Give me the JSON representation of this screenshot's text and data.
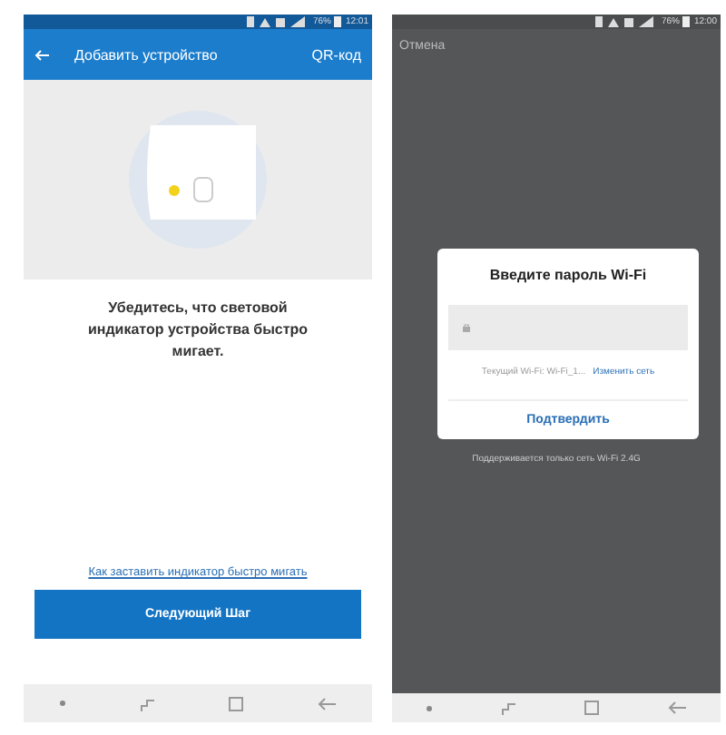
{
  "setup_screen": {
    "status_bar": {
      "battery": "76%",
      "time": "12:01"
    },
    "app_bar": {
      "title": "Добавить устройство",
      "action": "QR-код"
    },
    "instruction": "Убедитесь, что световой индикатор устройства быстро мигает.",
    "help_link": "Как заставить индикатор быстро мигать",
    "next_button": "Следующий Шаг"
  },
  "password_screen": {
    "status_bar": {
      "battery": "76%",
      "time": "12:00"
    },
    "cancel": "Отмена",
    "dialog": {
      "title": "Введите пароль Wi-Fi",
      "current_network": "Текущий Wi-Fi: Wi-Fi_1...",
      "change_network": "Изменить сеть",
      "confirm": "Подтвердить"
    },
    "note": "Поддерживается только сеть Wi-Fi 2.4G"
  }
}
